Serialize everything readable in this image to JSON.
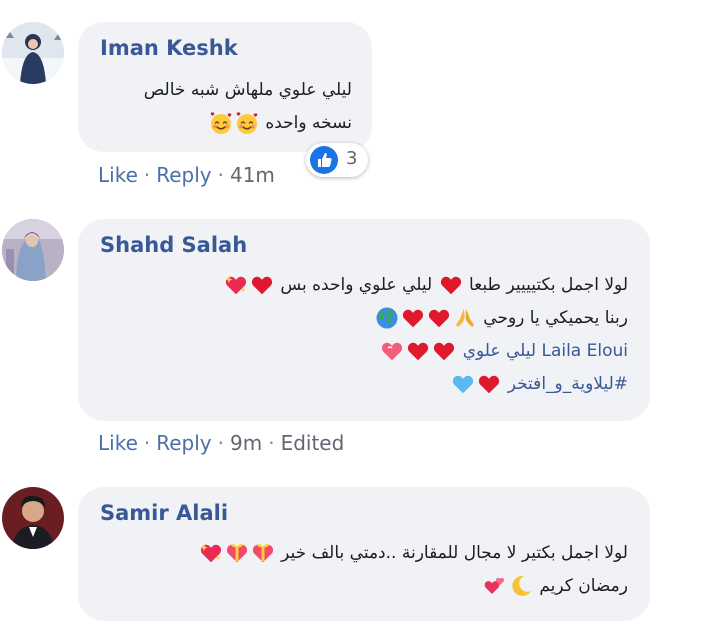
{
  "comments": [
    {
      "author": "Iman Keshk",
      "lines": [
        {
          "text": "ليلي علوي ملهاش شبه خالص"
        },
        {
          "text": "نسخه واحده"
        }
      ],
      "actions": {
        "like": "Like",
        "reply": "Reply",
        "time": "41m"
      },
      "reaction": {
        "icon": "like-icon",
        "count": "3"
      }
    },
    {
      "author": "Shahd Salah",
      "lines": [
        {
          "text": "لولا اجمل بكتيييير طبعا"
        },
        {
          "text2": "ليلي علوي واحده بس"
        },
        {
          "text": "ربنا يحميكي يا روحي"
        },
        {
          "link": "Laila Eloui",
          "text": "ليلي علوي"
        },
        {
          "hashtag": "#ليلاوية_و_افتخر"
        }
      ],
      "actions": {
        "like": "Like",
        "reply": "Reply",
        "time": "9m",
        "edited": "Edited"
      }
    },
    {
      "author": "Samir Alali",
      "lines": [
        {
          "text": "لولا اجمل بكتير لا مجال للمقارنة ..دمتي بالف خير"
        },
        {
          "text": "رمضان كريم"
        }
      ]
    }
  ],
  "colors": {
    "bubble": "#f0f2f5",
    "author": "#385898",
    "action": "#4b6fa8",
    "like_blue": "#1b74e4",
    "heart": "#e0182d"
  }
}
